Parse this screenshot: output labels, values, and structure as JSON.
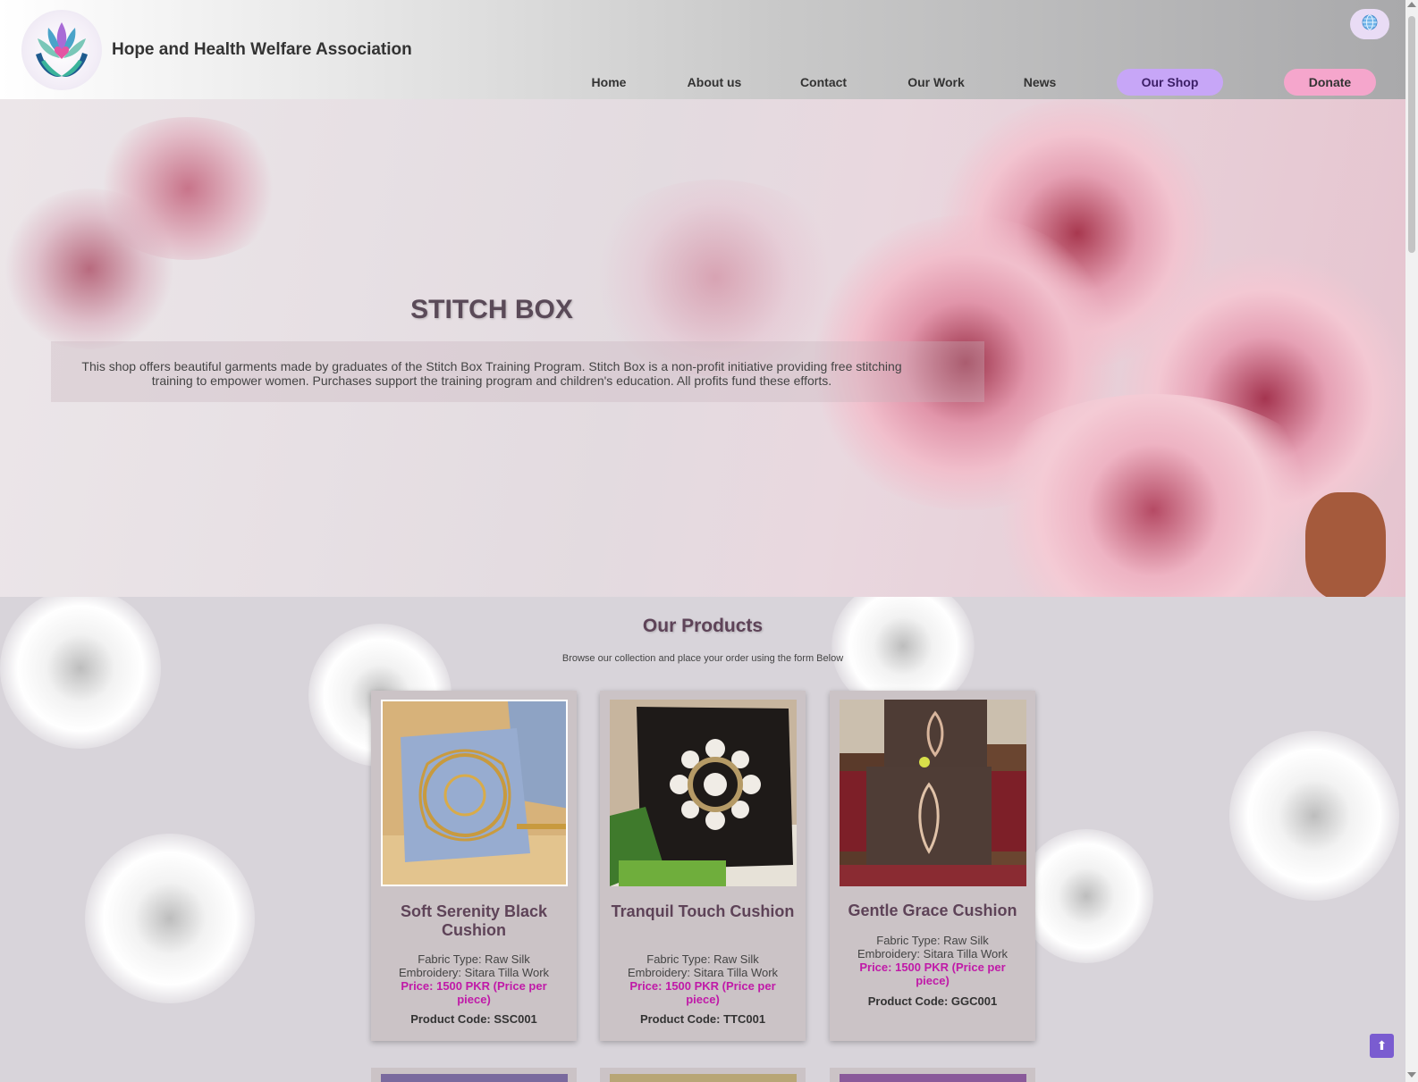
{
  "header": {
    "site_name": "Hope and Health Welfare Association",
    "logo_icon": "lotus-hands-heart-logo",
    "language_icon": "globe-icon",
    "nav": [
      {
        "label": "Home"
      },
      {
        "label": "About us"
      },
      {
        "label": "Contact"
      },
      {
        "label": "Our Work"
      },
      {
        "label": "News"
      },
      {
        "label": "Our Shop"
      },
      {
        "label": "Donate"
      }
    ],
    "colors": {
      "shop_pill": "#c7a6f7",
      "donate_pill": "#f5a6cc"
    }
  },
  "hero": {
    "title": "STITCH BOX",
    "description": "This shop offers beautiful garments made by graduates of the Stitch Box Training Program. Stitch Box is a non-profit initiative providing free stitching training to empower women. Purchases support the training program and children's education. All profits fund these efforts."
  },
  "products": {
    "title": "Our Products",
    "subtitle": "Browse our collection and place your order using the form Below",
    "items": [
      {
        "name": "Soft Serenity Black Cushion",
        "fabric": "Fabric Type: Raw Silk",
        "embroidery": "Embroidery: Sitara Tilla Work",
        "price": "Price: 1500 PKR (Price per piece)",
        "code": "Product Code: SSC001"
      },
      {
        "name": "Tranquil Touch Cushion",
        "fabric": "Fabric Type: Raw Silk",
        "embroidery": "Embroidery: Sitara Tilla Work",
        "price": "Price: 1500 PKR (Price per piece)",
        "code": "Product Code: TTC001"
      },
      {
        "name": "Gentle Grace Cushion",
        "fabric": "Fabric Type: Raw Silk",
        "embroidery": "Embroidery: Sitara Tilla Work",
        "price": "Price: 1500 PKR (Price per piece)",
        "code": "Product Code: GGC001"
      }
    ]
  },
  "back_to_top": "⬆"
}
